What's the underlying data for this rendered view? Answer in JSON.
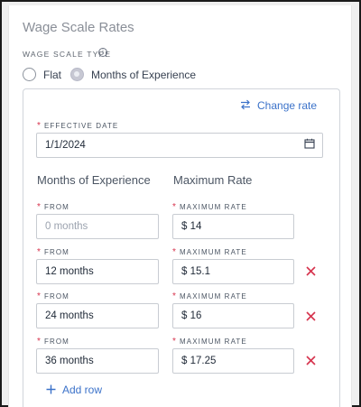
{
  "section": {
    "title": "Wage Scale Rates"
  },
  "wage_scale_type": {
    "label": "WAGE SCALE TYPE",
    "info_icon": "info-icon",
    "options": [
      {
        "label": "Flat",
        "selected": false
      },
      {
        "label": "Months of Experience",
        "selected": true
      }
    ]
  },
  "actions": {
    "change_rate": "Change rate",
    "change_rate_icon": "swap-arrows-icon",
    "add_row": "Add row",
    "add_row_icon": "plus-icon"
  },
  "effective_date": {
    "label": "EFFECTIVE DATE",
    "value": "1/1/2024",
    "icon": "calendar-icon"
  },
  "columns": {
    "from_header": "Months of Experience",
    "rate_header": "Maximum Rate"
  },
  "field_labels": {
    "from": "FROM",
    "rate": "MAXIMUM RATE"
  },
  "rows": [
    {
      "from": "",
      "from_placeholder": "0 months",
      "rate": "$ 14",
      "deletable": false
    },
    {
      "from": "12 months",
      "rate": "$ 15.1",
      "deletable": true
    },
    {
      "from": "24 months",
      "rate": "$ 16",
      "deletable": true
    },
    {
      "from": "36 months",
      "rate": "$ 17.25",
      "deletable": true
    }
  ],
  "colors": {
    "accent": "#3b72c9",
    "required": "#d6334d",
    "delete": "#d6334d"
  }
}
